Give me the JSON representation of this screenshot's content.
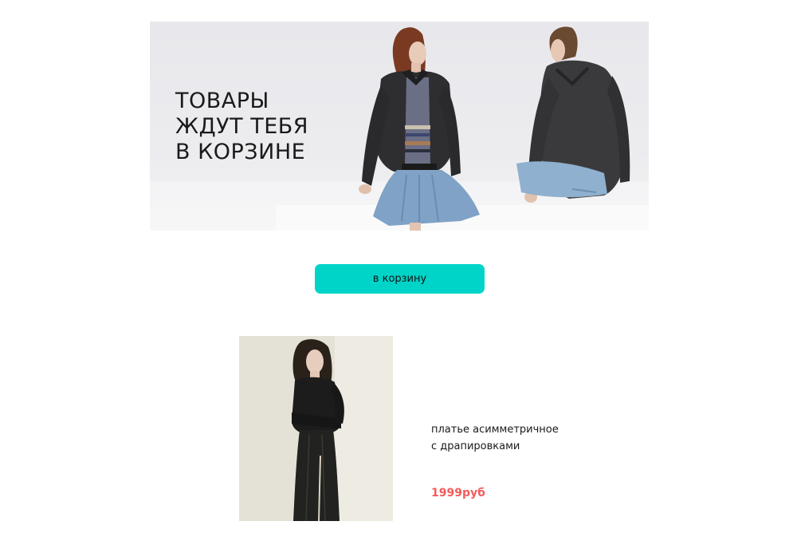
{
  "hero": {
    "title_lines": [
      "ТОВАРЫ",
      "ЖДУТ ТЕБЯ",
      "В КОРЗИНЕ"
    ]
  },
  "cart_button": {
    "label": "в корзину"
  },
  "product": {
    "name": "платье асимметричное с драпировками",
    "price": "1999руб"
  },
  "colors": {
    "button": "#00d4c8",
    "price": "#f25c5c",
    "text": "#1a1a1a"
  }
}
